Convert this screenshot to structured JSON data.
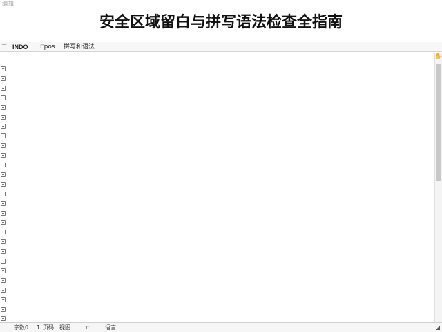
{
  "app": {
    "title": "编辑"
  },
  "page": {
    "title": "安全区域留白与拼写语法检查全指南"
  },
  "toolbar": {
    "leading_icon": "menu-icon",
    "items": [
      {
        "label": "INDO"
      },
      {
        "label": "Epos"
      },
      {
        "label": "拼写和语法"
      }
    ]
  },
  "gutter": {
    "marker_icon": "line-marker-icon",
    "marker_count": 28
  },
  "editor": {
    "content": ""
  },
  "scrollbar": {
    "top_icon": "hand-icon"
  },
  "status_bar": {
    "items": [
      {
        "label": "字数0"
      },
      {
        "label": "1"
      },
      {
        "label": "页码"
      },
      {
        "label": "视图"
      },
      {
        "label": "⊏"
      },
      {
        "label": "语言"
      }
    ],
    "corner_icon": "resize-icon"
  }
}
